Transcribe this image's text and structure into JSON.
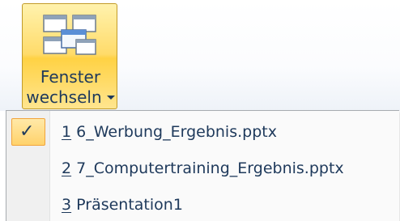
{
  "ribbon": {
    "switch_windows_button": {
      "label_line1": "Fenster",
      "label_line2": "wechseln",
      "icon": "switch-windows-icon"
    }
  },
  "menu": {
    "items": [
      {
        "accel": "1",
        "text": " 6_Werbung_Ergebnis.pptx",
        "checked": true
      },
      {
        "accel": "2",
        "text": " 7_Computertraining_Ergebnis.pptx",
        "checked": false
      },
      {
        "accel": "3",
        "text": " Präsentation1",
        "checked": false
      }
    ],
    "check_glyph": "✓"
  },
  "colors": {
    "highlight_fill": "#ffd26b",
    "highlight_border": "#f2a43a",
    "text": "#1e395b"
  }
}
